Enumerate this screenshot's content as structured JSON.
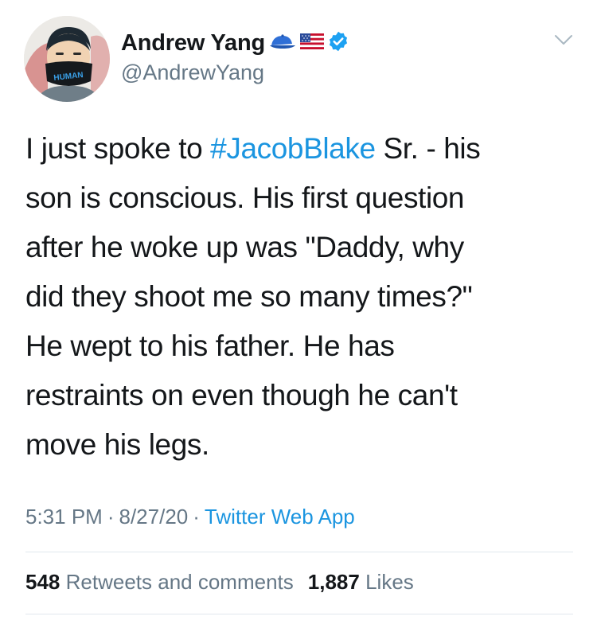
{
  "author": {
    "display_name": "Andrew Yang",
    "handle": "@AndrewYang",
    "avatar_mask_text": "HUMAN",
    "badges": [
      "cap-icon",
      "us-flag-icon",
      "verified-icon"
    ]
  },
  "tweet": {
    "lines": [
      {
        "before": "I just spoke to ",
        "hashtag": "#JacobBlake",
        "after": " Sr. - his"
      },
      {
        "text": "son is conscious.  His first question"
      },
      {
        "text": "after he woke up was \"Daddy, why"
      },
      {
        "text": "did they shoot me so many times?\""
      },
      {
        "text": "He wept to his father. He has"
      },
      {
        "text": "restraints on even though he can't"
      },
      {
        "text": "move his legs."
      }
    ]
  },
  "meta": {
    "time": "5:31 PM",
    "separator": "·",
    "date": "8/27/20",
    "source": "Twitter Web App"
  },
  "stats": {
    "retweets_count": "548",
    "retweets_label": "Retweets and comments",
    "likes_count": "1,887",
    "likes_label": "Likes"
  },
  "colors": {
    "link": "#1b95e0",
    "secondary_text": "#657786",
    "primary_text": "#14171a",
    "divider": "#e1e8ed",
    "verified": "#1da1f2"
  }
}
